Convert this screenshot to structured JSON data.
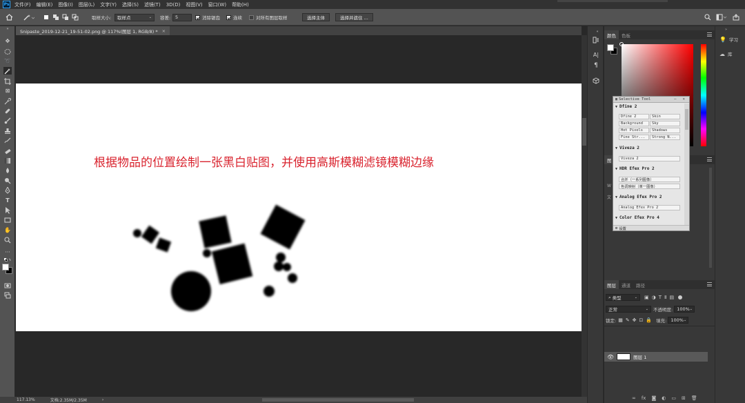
{
  "app": {
    "logo_text": "Ps"
  },
  "menu": [
    "文件(F)",
    "编辑(E)",
    "图像(I)",
    "图层(L)",
    "文字(Y)",
    "选择(S)",
    "滤镜(T)",
    "3D(D)",
    "视图(V)",
    "窗口(W)",
    "帮助(H)"
  ],
  "options": {
    "sample_size_label": "取样大小:",
    "sample_size_value": "取样点",
    "tolerance_label": "容差:",
    "tolerance_value": "5",
    "antialias_label": "消除锯齿",
    "contiguous_label": "连续",
    "all_layers_label": "对所有图层取样",
    "select_subject_button": "选择主体",
    "select_mask_button": "选择并遮住 ..."
  },
  "document": {
    "tab_title": "Snipaste_2019-12-21_19-51-02.png @ 117%(图层 1, RGB/8) *",
    "close_glyph": "×",
    "annotation": "根据物品的位置绘制一张黑白贴图，并使用高斯模糊滤镜模糊边缘"
  },
  "status": {
    "zoom": "117.13%",
    "doc_info": "文档:2.35M/2.35M",
    "arrow": "›"
  },
  "panels": {
    "color_tabs": [
      "颜色",
      "色板"
    ],
    "layer_tabs": [
      "图层",
      "通道",
      "路径"
    ],
    "kind_label": "类型",
    "blend_mode": "正常",
    "opacity_label": "不透明度:",
    "opacity_value": "100%",
    "lock_label": "锁定:",
    "fill_label": "填充:",
    "fill_value": "100%",
    "layer_name": "图层 1",
    "peek_chars": [
      "图",
      "W",
      "文"
    ]
  },
  "learn": {
    "learn_label": "学习",
    "lib_label": "库"
  },
  "selective_tool": {
    "title": "Selective Tool",
    "sections": [
      {
        "name": "Dfine 2",
        "items": [
          "Dfine 2",
          "Skin",
          "Background",
          "Sky",
          "Hot Pixels",
          "Shadows",
          "Fine Str...",
          "Strong N..."
        ]
      },
      {
        "name": "Viveza 2",
        "items": [
          "Viveza 2"
        ]
      },
      {
        "name": "HDR Efex Pro 2",
        "items": [
          "合并（一系列图像）",
          "色调映射（单一图像）"
        ]
      },
      {
        "name": "Analog Efex Pro 2",
        "items": [
          "Analog Efex Pro 2"
        ]
      },
      {
        "name": "Color Efex Pro 4",
        "items": []
      }
    ],
    "settings_label": "设置"
  },
  "colors": {
    "accent_red": "#d9232e",
    "fg_color": "#ffffff",
    "bg_color": "#000000"
  }
}
